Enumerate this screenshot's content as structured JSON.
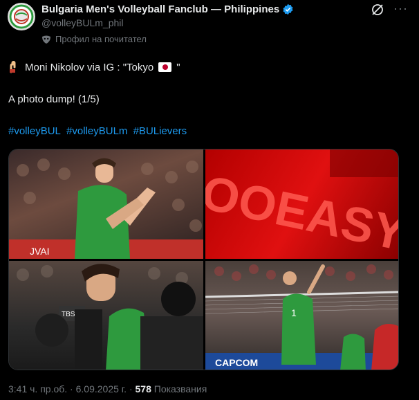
{
  "header": {
    "account_name": "Bulgaria Men's Volleyball Fanclub — Philippines",
    "handle": "@volleyBULm_phil",
    "profile_note": "Профил на почитател",
    "verified_icon": "verified-badge-icon",
    "grok_icon": "grok-icon",
    "more_label": "···"
  },
  "post": {
    "line1": "Moni Nikolov via IG : \"Tokyo",
    "line1_end": "\"",
    "line2": "A photo dump! (1/5)",
    "hashtags": [
      "#volleyBUL",
      "#volleyBULm",
      "#BULievers"
    ]
  },
  "photos": {
    "p2_text": "OOEASY",
    "p1_banner": "JVAI",
    "p4_banner": "CAPCOM",
    "p3_banner": "TBS",
    "jersey_number": "1"
  },
  "footer": {
    "time_date": "3:41 ч. пр.об. · 6.09.2025 г. · ",
    "views_count": "578",
    "views_label": " Показвания"
  },
  "colors": {
    "accent": "#1d9bf0",
    "verified": "#1d9bf0",
    "jersey": "#2e9a3e"
  }
}
